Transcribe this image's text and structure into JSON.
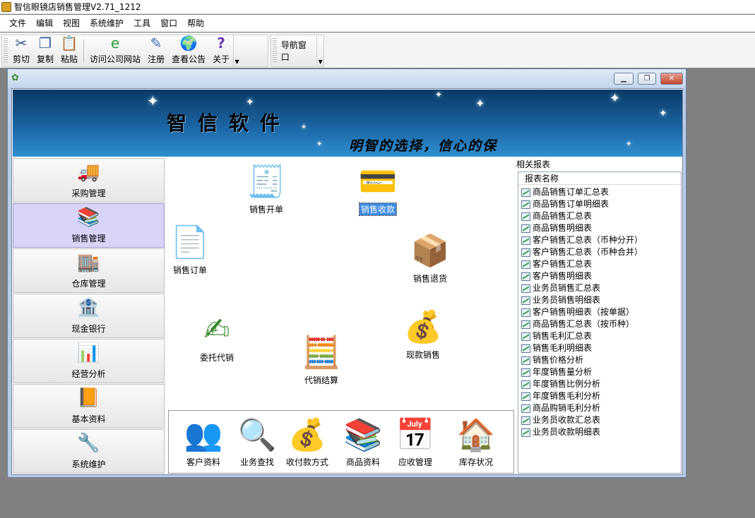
{
  "app": {
    "title": "智信眼镜店销售管理V2.71_1212"
  },
  "menu": [
    "文件",
    "编辑",
    "视图",
    "系统维护",
    "工具",
    "窗口",
    "帮助"
  ],
  "toolbar": {
    "buttons": [
      {
        "label": "剪切",
        "icon": "scissors-icon"
      },
      {
        "label": "复制",
        "icon": "copy-icon"
      },
      {
        "label": "粘贴",
        "icon": "paste-icon"
      },
      {
        "label": "访问公司网站",
        "icon": "globe-link-icon"
      },
      {
        "label": "注册",
        "icon": "register-icon"
      },
      {
        "label": "查看公告",
        "icon": "earth-icon"
      },
      {
        "label": "关于",
        "icon": "help-icon"
      }
    ],
    "nav_window": "导航窗口"
  },
  "banner": {
    "title": "智信软件",
    "slogan": "明智的选择，信心的保"
  },
  "nav": [
    {
      "label": "采购管理",
      "icon": "truck-icon"
    },
    {
      "label": "销售管理",
      "icon": "books-icon",
      "active": true
    },
    {
      "label": "仓库管理",
      "icon": "warehouse-icon"
    },
    {
      "label": "现金银行",
      "icon": "bank-icon"
    },
    {
      "label": "经营分析",
      "icon": "bar-chart-icon"
    },
    {
      "label": "基本资料",
      "icon": "book-icon"
    },
    {
      "label": "系统维护",
      "icon": "tools-icon"
    }
  ],
  "functions": {
    "sales_open": "销售开单",
    "sales_receipt": "销售收款",
    "sales_order": "销售订单",
    "sales_return": "销售退货",
    "consign": "委托代销",
    "consign_settle": "代销结算",
    "cash_sale": "现款销售"
  },
  "bottom_items": [
    "客户资料",
    "业务查找",
    "收付款方式",
    "商品资料",
    "应收管理",
    "库存状况"
  ],
  "reports": {
    "title": "相关报表",
    "header": "报表名称",
    "items": [
      "商品销售订单汇总表",
      "商品销售订单明细表",
      "商品销售汇总表",
      "商品销售明细表",
      "客户销售汇总表（币种分开）",
      "客户销售汇总表（币种合并）",
      "客户销售汇总表",
      "客户销售明细表",
      "业务员销售汇总表",
      "业务员销售明细表",
      "客户销售明细表（按单据）",
      "商品销售汇总表（按币种）",
      "销售毛利汇总表",
      "销售毛利明细表",
      "销售价格分析",
      "年度销售量分析",
      "年度销售比例分析",
      "年度销售毛利分析",
      "商品购销毛利分析",
      "业务员收款汇总表",
      "业务员收款明细表"
    ]
  },
  "colors": {
    "accent": "#3a8be0",
    "nav_active": "#d7d4f7",
    "banner": "#1b64a3"
  }
}
